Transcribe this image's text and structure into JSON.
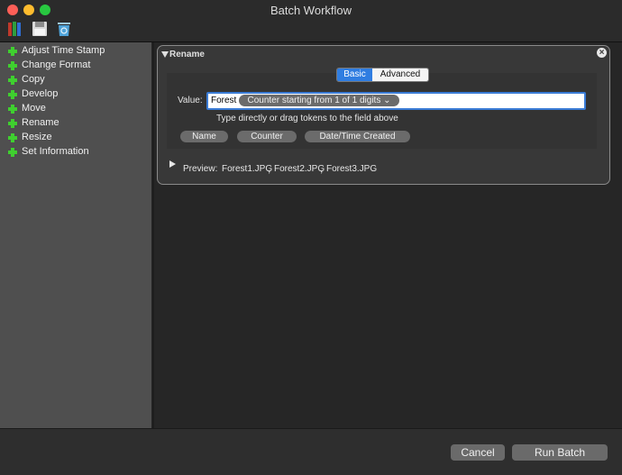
{
  "window": {
    "title": "Batch Workflow"
  },
  "toolbar": {
    "icons": [
      "books-icon",
      "save-icon",
      "trash-icon"
    ],
    "colors": {
      "books": [
        "#c0392b",
        "#2e9e3f",
        "#2f6fd6"
      ],
      "disk": "#d9d9d9",
      "trash": "#4fa3d9"
    }
  },
  "sidebar": {
    "items": [
      {
        "label": "Adjust Time Stamp"
      },
      {
        "label": "Change Format"
      },
      {
        "label": "Copy"
      },
      {
        "label": "Develop"
      },
      {
        "label": "Move"
      },
      {
        "label": "Rename"
      },
      {
        "label": "Resize"
      },
      {
        "label": "Set Information"
      }
    ],
    "plus_color": "#3fcf2f"
  },
  "panel": {
    "title": "Rename",
    "tabs": {
      "basic": "Basic",
      "advanced": "Advanced",
      "selected": "Basic"
    },
    "value_label": "Value:",
    "value_text": "Forest",
    "value_token": "Counter starting from 1 of 1 digits ⌄",
    "hint": "Type directly or drag tokens to the field above",
    "tokens": [
      "Name",
      "Counter",
      "Date/Time Created"
    ],
    "preview_label": "Preview:",
    "preview_files": [
      "Forest1.JPG",
      "Forest2.JPG",
      "Forest3.JPG"
    ],
    "preview_sep": ","
  },
  "footer": {
    "cancel": "Cancel",
    "run": "Run Batch"
  },
  "accent": "#2f7de1"
}
